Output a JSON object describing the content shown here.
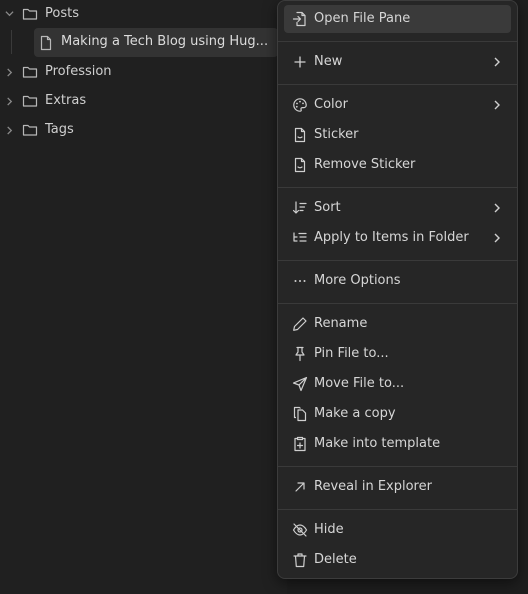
{
  "tree": {
    "folders": [
      {
        "label": "Posts",
        "expanded": true
      },
      {
        "label": "Profession",
        "expanded": false
      },
      {
        "label": "Extras",
        "expanded": false
      },
      {
        "label": "Tags",
        "expanded": false
      }
    ],
    "file": {
      "label": "Making a Tech Blog using Hug..."
    }
  },
  "menu": {
    "open_file_pane": "Open File Pane",
    "new": "New",
    "color": "Color",
    "sticker": "Sticker",
    "remove_sticker": "Remove Sticker",
    "sort": "Sort",
    "apply_to_items": "Apply to Items in Folder",
    "more_options": "More Options",
    "rename": "Rename",
    "pin_file": "Pin File to...",
    "move_file": "Move File to...",
    "make_copy": "Make a copy",
    "make_template": "Make into template",
    "reveal": "Reveal in Explorer",
    "hide": "Hide",
    "delete": "Delete"
  }
}
